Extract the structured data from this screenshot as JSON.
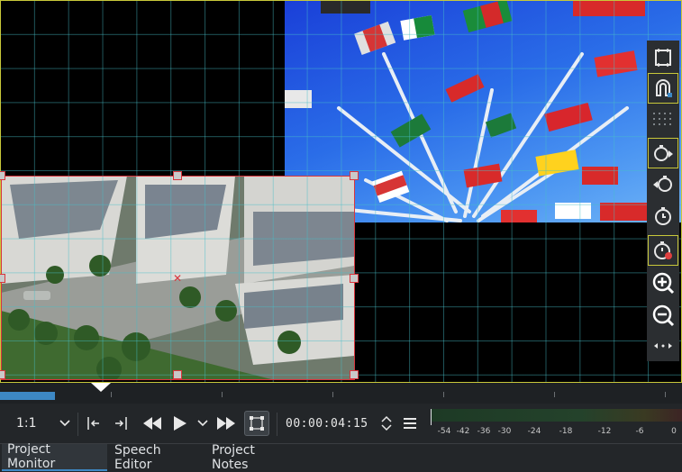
{
  "monitor": {
    "toolbar": [
      {
        "name": "fullscreen-icon",
        "active": false
      },
      {
        "name": "magnet-icon",
        "active": true
      },
      {
        "name": "grid-dots-icon",
        "active": false
      },
      {
        "name": "rewind-play-icon",
        "active": true
      },
      {
        "name": "stopwatch-left-icon",
        "active": false
      },
      {
        "name": "stopwatch-add-icon",
        "active": false
      },
      {
        "name": "stopwatch-record-icon",
        "active": true
      },
      {
        "name": "zoom-in-icon",
        "active": false
      },
      {
        "name": "zoom-out-icon",
        "active": false
      },
      {
        "name": "more-icon",
        "active": false
      }
    ]
  },
  "ruler": {
    "progress": 0.08
  },
  "controls": {
    "zoom": "1:1",
    "timecode": "00:00:04:15"
  },
  "audio_meter": {
    "labels": [
      "-54",
      "-42",
      "-36",
      "-30",
      "-24",
      "-18",
      "-12",
      "-6",
      "0"
    ]
  },
  "tabs": [
    {
      "label": "Project Monitor",
      "active": true
    },
    {
      "label": "Speech Editor",
      "active": false
    },
    {
      "label": "Project Notes",
      "active": false
    }
  ],
  "colors": {
    "selection": "#d9353d",
    "frame_border": "#c8c83a",
    "accent": "#3d88c4"
  }
}
